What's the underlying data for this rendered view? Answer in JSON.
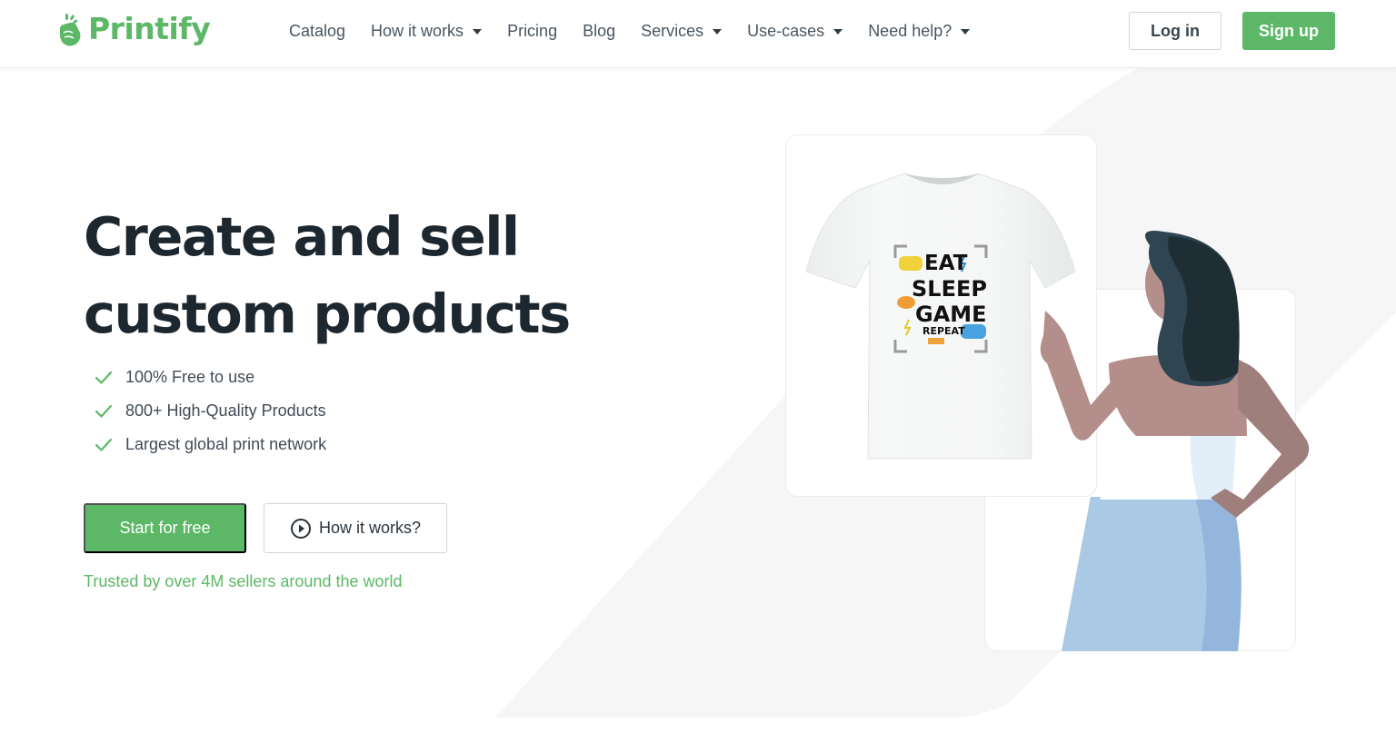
{
  "brand": {
    "name": "Printify",
    "accent": "#5cb867",
    "text_dark": "#1d272f"
  },
  "nav": {
    "items": [
      {
        "label": "Catalog",
        "dropdown": false
      },
      {
        "label": "How it works",
        "dropdown": true
      },
      {
        "label": "Pricing",
        "dropdown": false
      },
      {
        "label": "Blog",
        "dropdown": false
      },
      {
        "label": "Services",
        "dropdown": true
      },
      {
        "label": "Use-cases",
        "dropdown": true
      },
      {
        "label": "Need help?",
        "dropdown": true
      }
    ],
    "login_label": "Log in",
    "signup_label": "Sign up"
  },
  "hero": {
    "headline_line1": "Create and sell",
    "headline_line2": "custom products",
    "features": [
      "100% Free to use",
      "800+ High-Quality Products",
      "Largest global print network"
    ],
    "primary_cta": "Start for free",
    "secondary_cta": "How it works?",
    "trusted_text": "Trusted by over 4M sellers around the world"
  },
  "illustration": {
    "shirt_design": {
      "line1": "EAT",
      "line2": "SLEEP",
      "line3": "GAME",
      "line4": "REPEAT"
    },
    "colors": {
      "skin": "#b38e8a",
      "hair_dark": "#1f2d35",
      "hair_light": "#2f4552",
      "skirt": "#a9c9e4",
      "skirt_shade": "#94b5dc"
    }
  }
}
